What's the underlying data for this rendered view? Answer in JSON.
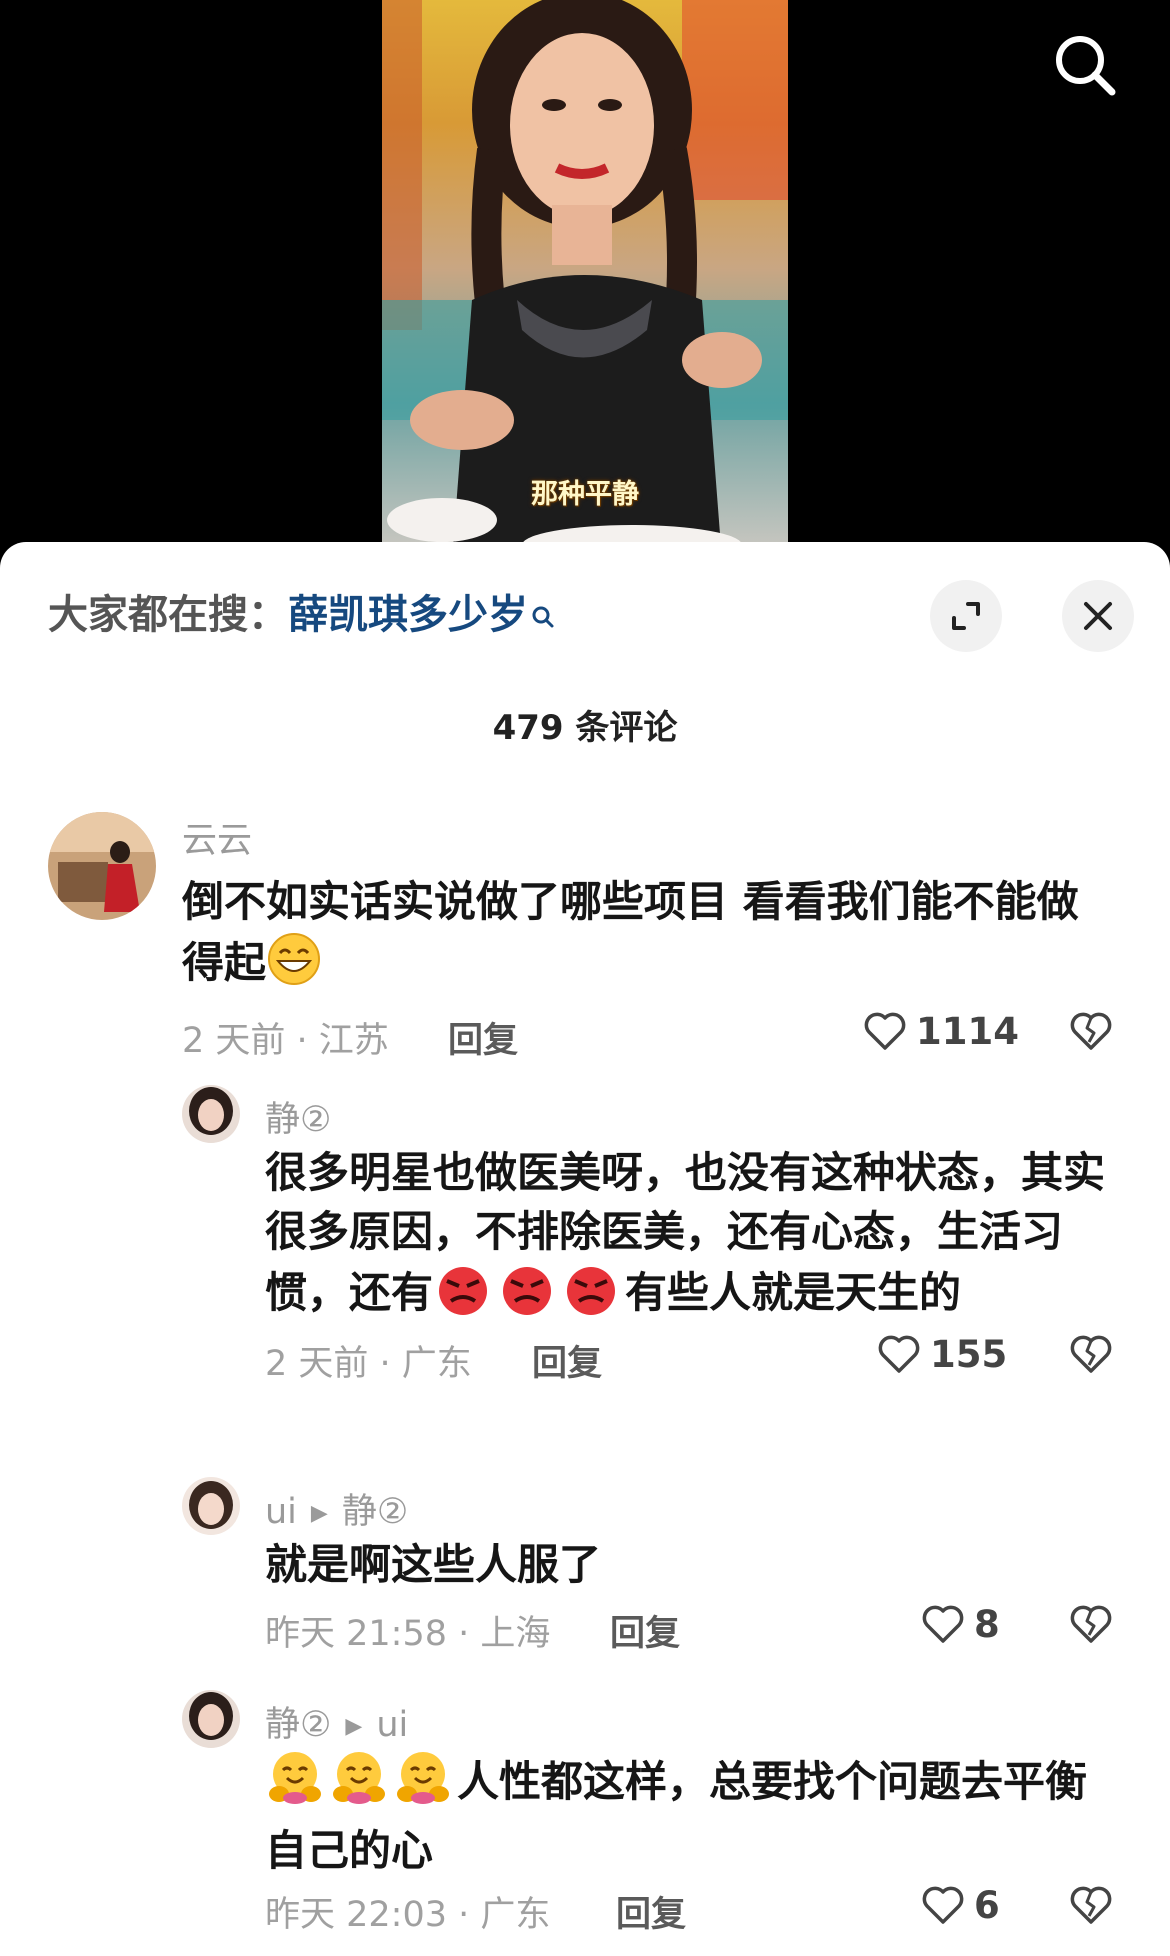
{
  "video": {
    "subtitle": "那种平静"
  },
  "icons": {
    "search": "search-icon",
    "expand": "expand-icon",
    "close": "close-icon",
    "like": "heart-outline-icon",
    "dislike": "broken-heart-icon"
  },
  "header": {
    "hot_search_prefix": "大家都在搜：",
    "hot_search_term": "薛凯琪多少岁",
    "comment_count": "479 条评论"
  },
  "comments": [
    {
      "author": "云云",
      "text_before": "倒不如实话实说做了哪些项目 看看我们能不能做得起",
      "emoji": "grinning-face",
      "time": "2 天前 · 江苏",
      "reply_label": "回复",
      "likes": "1114"
    },
    {
      "author": "静②",
      "text_before": "很多明星也做医美呀，也没有这种状态，其实很多原因，不排除医美，还有心态，生活习惯，还有",
      "emoji": "angry-face",
      "emoji_count": 3,
      "text_after": "有些人就是天生的",
      "time": "2 天前 · 广东",
      "reply_label": "回复",
      "likes": "155"
    },
    {
      "author": "ui",
      "reply_to": "静②",
      "text": "就是啊这些人服了",
      "time": "昨天 21:58 · 上海",
      "reply_label": "回复",
      "likes": "8"
    },
    {
      "author": "静②",
      "reply_to": "ui",
      "emoji": "hugging-face",
      "emoji_count": 3,
      "text_after": "人性都这样，总要找个问题去平衡自己的心",
      "time": "昨天 22:03 · 广东",
      "reply_label": "回复",
      "likes": "6"
    }
  ],
  "colors": {
    "sheet_bg": "#ffffff",
    "link": "#16497f",
    "meta": "#a0a0a0"
  }
}
